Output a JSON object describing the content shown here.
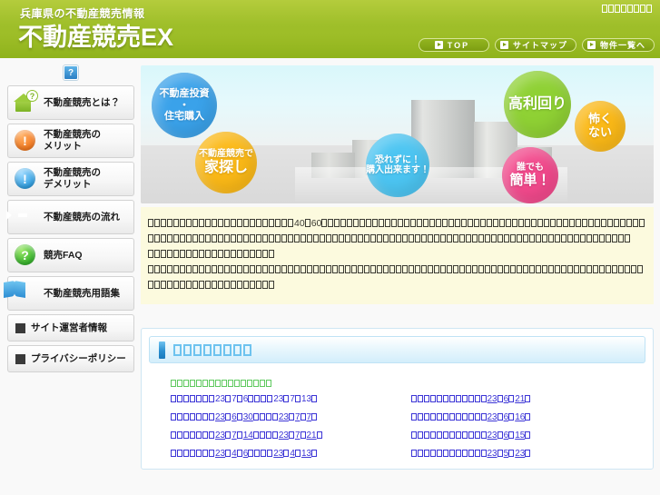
{
  "header": {
    "subtitle": "兵庫県の不動産競売情報",
    "title": "不動産競売EX",
    "contact_tofu": 8,
    "nav": [
      {
        "label": "TOP",
        "icon": "play-square-icon",
        "wide": true
      },
      {
        "label": "サイトマップ",
        "icon": "play-square-icon",
        "wide": false
      },
      {
        "label": "物件一覧へ",
        "icon": "play-square-icon",
        "wide": false
      }
    ]
  },
  "sidebar": {
    "help_badge": "?",
    "items": [
      {
        "label": "不動産競売とは？",
        "icon": "house-question-icon"
      },
      {
        "label": "不動産競売の\nメリット",
        "line1": "不動産競売の",
        "line2": "メリット",
        "icon": "exclamation-orange-icon"
      },
      {
        "label": "不動産競売の\nデメリット",
        "line1": "不動産競売の",
        "line2": "デメリット",
        "icon": "exclamation-blue-icon"
      },
      {
        "label": "不動産競売の流れ",
        "icon": "arrow-right-icon"
      },
      {
        "label": "競売FAQ",
        "icon": "question-green-icon"
      },
      {
        "label": "不動産競売用語集",
        "icon": "book-icon"
      },
      {
        "label": "サイト運営者情報",
        "icon": "square-bullet-icon",
        "plain": true
      },
      {
        "label": "プライバシーポリシー",
        "icon": "square-bullet-icon",
        "plain": true
      }
    ]
  },
  "banner": {
    "bubbles": [
      {
        "name": "investment",
        "line1": "不動産投資",
        "line2": "・",
        "line3": "住宅購入",
        "color": "#3aa2ea"
      },
      {
        "name": "house-hunting",
        "small": "不動産競売で",
        "big": "家探し",
        "color": "#fbb917"
      },
      {
        "name": "no-fear-purchase",
        "line1": "恐れずに！",
        "line2": "購入出来ます！",
        "color": "#4cc5f2"
      },
      {
        "name": "high-yield",
        "line1": "高利回り",
        "color": "#8fd134"
      },
      {
        "name": "not-scary",
        "line1": "怖く",
        "line2": "ない",
        "color": "#fbb917"
      },
      {
        "name": "easy-for-anyone",
        "small": "誰でも",
        "big": "簡単！",
        "color": "#f2498c"
      }
    ]
  },
  "intro": {
    "lines": [
      {
        "tofu_before": 23,
        "text_mid": "40",
        "tofu_mid": 1,
        "text_mid2": "60",
        "tofu_after": 51
      },
      {
        "tofu_before": 76
      },
      {
        "tofu_before": 20
      },
      {
        "tofu_before": 78
      },
      {
        "tofu_before": 20
      }
    ]
  },
  "news": {
    "heading_tofu": 8,
    "category_tofu": 16,
    "columns": [
      {
        "links": [
          {
            "tofu1": 7,
            "d1": "23",
            "d2": "7",
            "d3": "6",
            "tofu2": 3,
            "d4": "23",
            "d5": "7",
            "d6": "13",
            "underline": false
          },
          {
            "tofu1": 7,
            "d1": "23",
            "d2": "6",
            "d3": "30",
            "tofu2": 3,
            "d4": "23",
            "d5": "7",
            "d6": "7",
            "underline": true
          },
          {
            "tofu1": 7,
            "d1": "23",
            "d2": "7",
            "d3": "14",
            "tofu2": 3,
            "d4": "23",
            "d5": "7",
            "d6": "21",
            "underline": true
          },
          {
            "tofu1": 7,
            "d1": "23",
            "d2": "4",
            "d3": "6",
            "tofu2": 3,
            "d4": "23",
            "d5": "4",
            "d6": "13",
            "underline": true
          }
        ]
      },
      {
        "links": [
          {
            "tofu1": 12,
            "d1": "23",
            "d2": "6",
            "d3": "21",
            "underline": true
          },
          {
            "tofu1": 12,
            "d1": "23",
            "d2": "6",
            "d3": "16",
            "underline": true
          },
          {
            "tofu1": 12,
            "d1": "23",
            "d2": "6",
            "d3": "15",
            "underline": true
          },
          {
            "tofu1": 12,
            "d1": "23",
            "d2": "5",
            "d3": "23",
            "underline": true
          }
        ]
      }
    ]
  },
  "colors": {
    "header_green": "#9dbd27",
    "accent_blue": "#3aa2ea",
    "link_blue": "#3b34d6",
    "category_green": "#5ec95e",
    "intro_bg": "#fcfade"
  }
}
